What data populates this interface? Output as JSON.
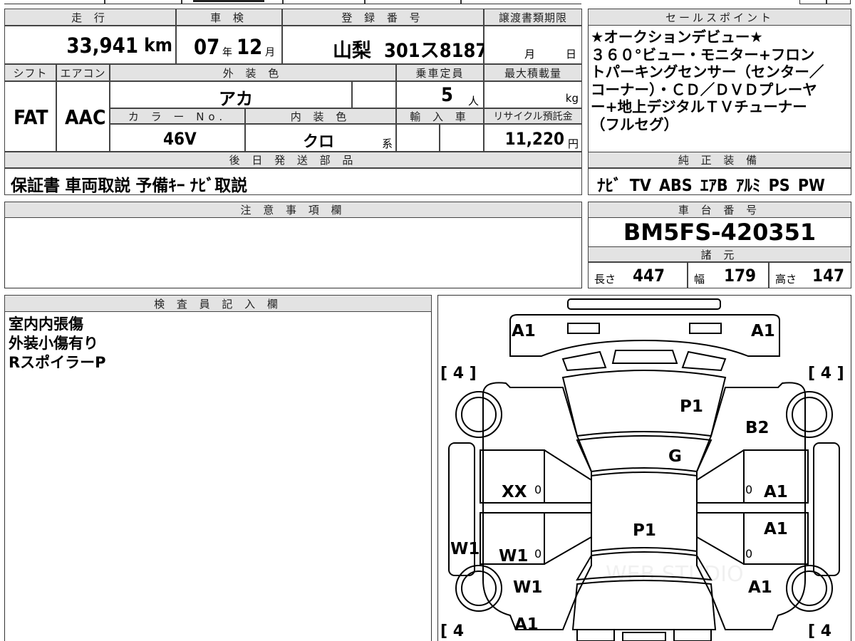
{
  "top_strip": {},
  "vehicle": {
    "mileage_header": "走 行",
    "mileage_value": "33,941",
    "mileage_unit": "km",
    "inspection_header": "車 検",
    "inspection_year": "07",
    "inspection_year_unit": "年",
    "inspection_month": "12",
    "inspection_month_unit": "月",
    "registration_header": "登 録 番 号",
    "registration_region": "山梨",
    "registration_number": "301ス8187",
    "transfer_header": "譲渡書類期限",
    "transfer_month_unit": "月",
    "transfer_day_unit": "日",
    "shift_header": "シフト",
    "shift_value": "FAT",
    "aircon_header": "エアコン",
    "aircon_value": "AAC",
    "exterior_header": "外 装 色",
    "exterior_value": "アカ",
    "capacity_header": "乗車定員",
    "capacity_value": "5",
    "capacity_unit": "人",
    "load_header": "最大積載量",
    "load_unit": "kg",
    "color_no_header": "カ ラ ー No.",
    "color_no_value": "46V",
    "interior_header": "内 装 色",
    "interior_value": "クロ",
    "interior_suffix": "系",
    "import_header": "輸 入 車",
    "recycle_header": "リサイクル預託金",
    "recycle_value": "11,220",
    "recycle_unit": "円",
    "later_parts_header": "後 日 発 送 部 品",
    "later_parts_value": "保証書 車両取説 予備ｷｰ ﾅﾋﾞ取説"
  },
  "sales": {
    "header": "セールスポイント",
    "lines": [
      "★オークションデビュー★",
      "３６０°ビュー・モニター+フロン",
      "トパーキングセンサー（センター／",
      "コーナー）・ＣＤ／ＤＶＤプレーヤ",
      "ー+地上デジタルＴＶチューナー",
      "（フルセグ）"
    ],
    "equipment_header": "純 正 装 備",
    "equipment_value": "ﾅﾋﾞ TV ABS ｴｱB ｱﾙﾐ PS PW"
  },
  "notes": {
    "header": "注 意 事 項 欄"
  },
  "chassis": {
    "header": "車 台 番 号",
    "value": "BM5FS-420351",
    "spec_header": "諸 元",
    "length_label": "長さ",
    "length_value": "447",
    "width_label": "幅",
    "width_value": "179",
    "height_label": "高さ",
    "height_value": "147"
  },
  "inspector": {
    "header": "検 査 員 記 入 欄",
    "lines": [
      "室内内張傷",
      "外装小傷有り",
      "RスポイラーP"
    ]
  },
  "diagram": {
    "tire_tl": "[ 4 ]",
    "tire_tr": "[ 4 ]",
    "tire_bl": "[ 4",
    "tire_br": "[ 4",
    "labels": {
      "a1_tl": "A1",
      "a1_tr": "A1",
      "p1_hood": "P1",
      "b2": "B2",
      "g": "G",
      "xx": "XX",
      "a1_rf": "A1",
      "a1_rr": "A1",
      "p1_roof": "P1",
      "w1_side": "W1",
      "w1_rl": "W1",
      "w1_rear": "W1",
      "a1_rb": "A1",
      "a1_bottom": "A1",
      "zero_l1": "0",
      "zero_l2": "0",
      "zero_r1": "0",
      "zero_r2": "0"
    },
    "watermark": "WEB STUDIO"
  }
}
